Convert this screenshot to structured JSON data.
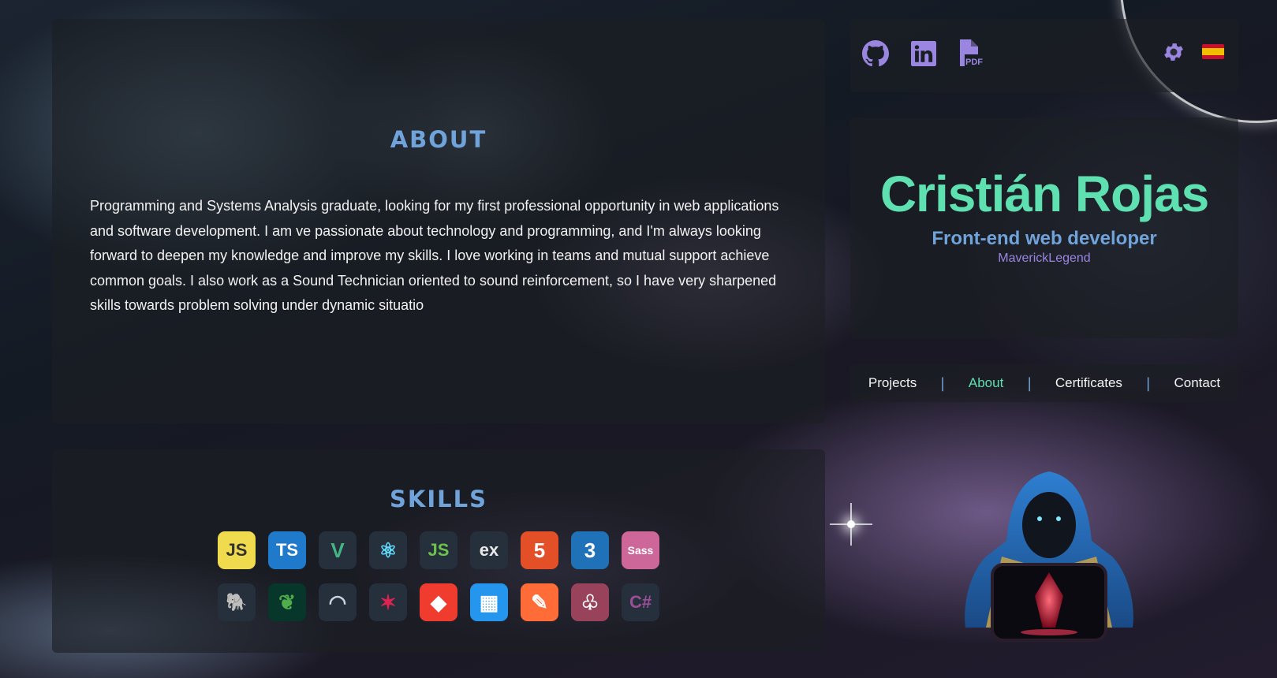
{
  "about": {
    "title": "ABOUT",
    "text": "Programming and Systems Analysis graduate, looking for my first professional opportunity in web applications and software development. I am ve passionate about technology and programming, and I'm always looking forward to deepen my knowledge and improve my skills. I love working in teams and mutual support achieve common goals. I also work as a Sound Technician oriented to sound reinforcement, so I have very sharpened skills towards problem solving under dynamic situatio"
  },
  "skills": {
    "title": "SKILLS",
    "row1": [
      {
        "name": "javascript-icon",
        "label": "JS",
        "bg": "#f0db4f",
        "fg": "#323330"
      },
      {
        "name": "typescript-icon",
        "label": "TS",
        "bg": "#1f7acb",
        "fg": "#ffffff"
      },
      {
        "name": "vue-icon",
        "label": "V",
        "bg": "#26303d",
        "fg": "#41b883"
      },
      {
        "name": "react-icon",
        "label": "⚛",
        "bg": "#26303d",
        "fg": "#61dafb"
      },
      {
        "name": "nodejs-icon",
        "label": "JS",
        "bg": "#26303d",
        "fg": "#6cc24a"
      },
      {
        "name": "express-icon",
        "label": "ex",
        "bg": "#26303d",
        "fg": "#e8e8e8"
      },
      {
        "name": "html5-icon",
        "label": "5",
        "bg": "#e34f26",
        "fg": "#ffffff"
      },
      {
        "name": "css3-icon",
        "label": "3",
        "bg": "#1f72b8",
        "fg": "#ffffff"
      },
      {
        "name": "sass-icon",
        "label": "Sass",
        "bg": "#cd6799",
        "fg": "#ffffff"
      }
    ],
    "row2": [
      {
        "name": "postgresql-icon",
        "label": "🐘",
        "bg": "#26303d",
        "fg": "#c9d6e6"
      },
      {
        "name": "mongodb-icon",
        "label": "❦",
        "bg": "#06372a",
        "fg": "#4fad4b"
      },
      {
        "name": "mysql-icon",
        "label": "◠",
        "bg": "#26303d",
        "fg": "#c9d6e6"
      },
      {
        "name": "nestjs-icon",
        "label": "✶",
        "bg": "#26303d",
        "fg": "#e0234e"
      },
      {
        "name": "git-icon",
        "label": "◆",
        "bg": "#f03c2e",
        "fg": "#ffffff"
      },
      {
        "name": "docker-icon",
        "label": "▦",
        "bg": "#2496ed",
        "fg": "#ffffff"
      },
      {
        "name": "postman-icon",
        "label": "✎",
        "bg": "#ff6c37",
        "fg": "#ffffff"
      },
      {
        "name": "jest-icon",
        "label": "♧",
        "bg": "#99425b",
        "fg": "#ffffff"
      },
      {
        "name": "csharp-icon",
        "label": "C#",
        "bg": "#26303d",
        "fg": "#9b4f96"
      }
    ]
  },
  "header": {
    "icons": [
      "github-icon",
      "linkedin-icon",
      "pdf-file-icon",
      "gear-icon",
      "spain-flag-icon"
    ],
    "icon_color": "#9a86e0"
  },
  "profile": {
    "name": "Cristián Rojas",
    "role": "Front-end web developer",
    "handle": "MaverickLegend"
  },
  "nav": {
    "items": [
      {
        "label": "Projects",
        "active": false
      },
      {
        "label": "About",
        "active": true
      },
      {
        "label": "Certificates",
        "active": false
      },
      {
        "label": "Contact",
        "active": false
      }
    ],
    "separator": "|"
  },
  "colors": {
    "accent_green": "#5fe0b0",
    "accent_blue": "#6fa3da",
    "accent_purple": "#9a86e0"
  }
}
